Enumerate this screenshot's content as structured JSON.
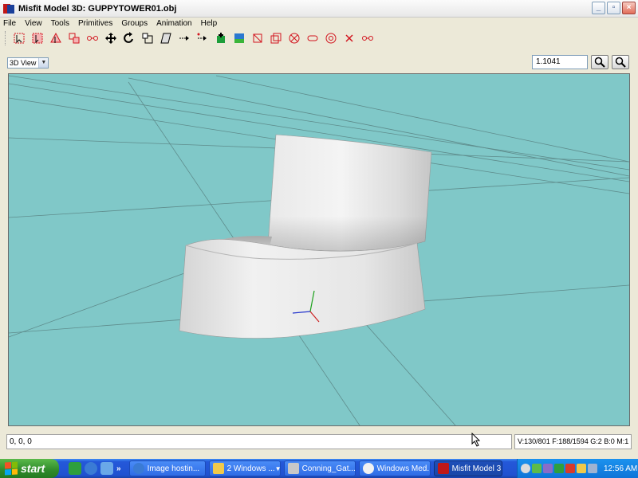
{
  "window": {
    "title": "Misfit Model 3D: GUPPYTOWER01.obj",
    "minimize": "_",
    "maximize": "▫",
    "close": "×"
  },
  "menu": {
    "items": [
      "File",
      "View",
      "Tools",
      "Primitives",
      "Groups",
      "Animation",
      "Help"
    ]
  },
  "toolbar": {
    "icons": [
      "select-vertices-icon",
      "select-faces-icon",
      "select-connected-icon",
      "select-groups-icon",
      "select-bones-icon",
      "move-icon",
      "rotate-icon",
      "scale-icon",
      "shear-icon",
      "extrude-icon",
      "add-vertex-icon",
      "add-face-icon",
      "background-icon",
      "cube-icon",
      "ellipsoid-icon",
      "cylinder-icon",
      "capsule-icon",
      "torus-icon",
      "polygon-icon",
      "joint-icon"
    ]
  },
  "viewbar": {
    "view_mode": "3D View",
    "zoom_value": "1.1041"
  },
  "status": {
    "coordinates": "0, 0, 0",
    "stats": "V:130/801 F:188/1594 G:2 B:0 M:1"
  },
  "taskbar": {
    "start_label": "start",
    "more": "»",
    "tasks": [
      {
        "label": "Image hostin..."
      },
      {
        "label": "2 Windows ..."
      },
      {
        "label": "Conning_Gat..."
      },
      {
        "label": "Windows Med..."
      },
      {
        "label": "Misfit Model 3..."
      }
    ],
    "clock": "12:56 AM"
  },
  "colors": {
    "viewport_bg": "#80c8c8",
    "taskbar": "#2458d9",
    "tool_red": "#d2141e"
  }
}
